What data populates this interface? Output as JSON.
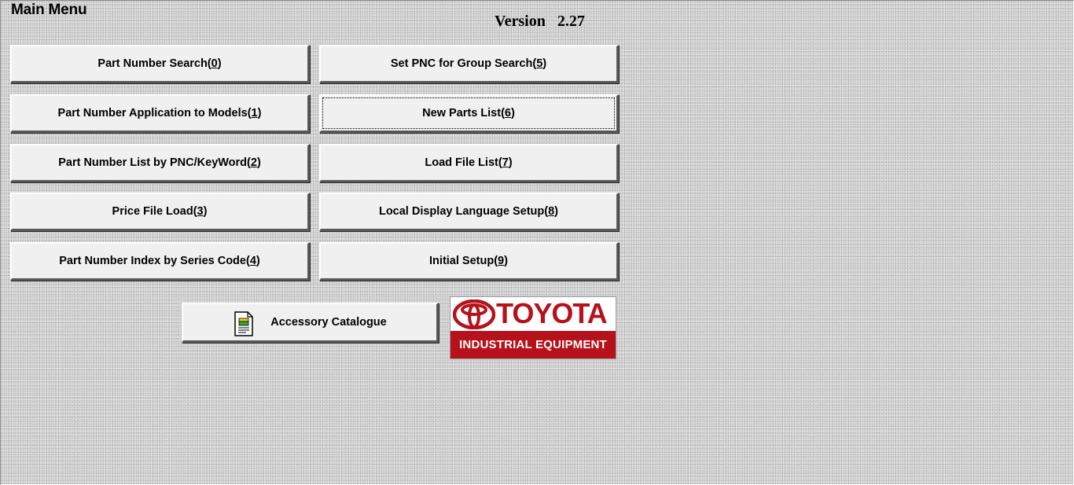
{
  "window": {
    "title": "Main Menu",
    "version": "Version   2.27"
  },
  "menu": {
    "buttons": [
      {
        "text": "Part Number Search(",
        "key": "0",
        "end": ")"
      },
      {
        "text": "Part Number Application to Models(",
        "key": "1",
        "end": ")"
      },
      {
        "text": "Part Number List by PNC/KeyWord(",
        "key": "2",
        "end": ")"
      },
      {
        "text": "Price File Load(",
        "key": "3",
        "end": ")"
      },
      {
        "text": "Part Number Index by Series Code(",
        "key": "4",
        "end": ")"
      },
      {
        "text": "Set PNC for Group Search(",
        "key": "5",
        "end": ")"
      },
      {
        "text": "New Parts List(",
        "key": "6",
        "end": ")"
      },
      {
        "text": "Load File List(",
        "key": "7",
        "end": ")"
      },
      {
        "text": "Local Display Language Setup(",
        "key": "8",
        "end": ")"
      },
      {
        "text": "Initial Setup(",
        "key": "9",
        "end": ")"
      }
    ]
  },
  "accessory": {
    "label": "Accessory Catalogue",
    "icon": "document-icon"
  },
  "logo": {
    "brand": "TOYOTA",
    "subtitle": "INDUSTRIAL EQUIPMENT",
    "color": "#b5121b"
  }
}
